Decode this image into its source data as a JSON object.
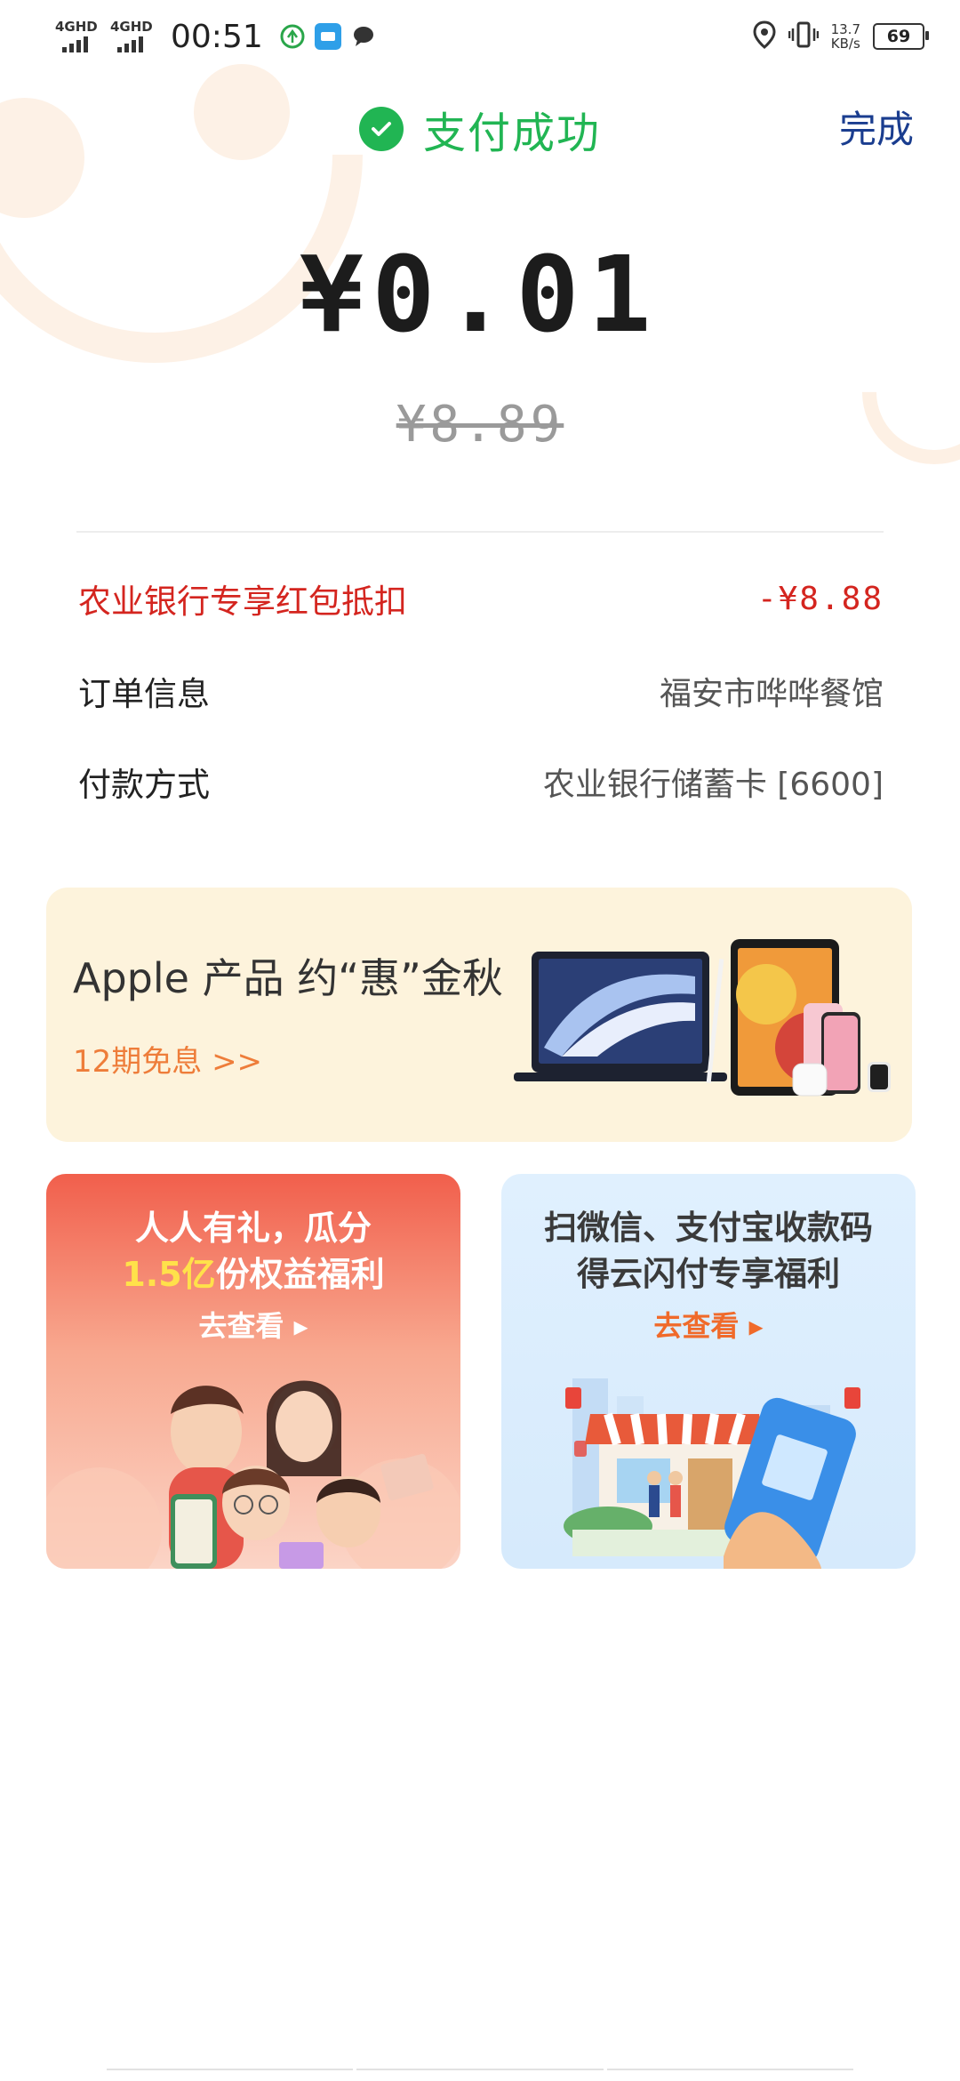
{
  "status_bar": {
    "network1": "4GHD",
    "network2": "4GHD",
    "time": "00:51",
    "speed_value": "13.7",
    "speed_unit": "KB/s",
    "battery": "69"
  },
  "header": {
    "status_text": "支付成功",
    "done_label": "完成"
  },
  "payment": {
    "amount": "¥0.01",
    "original_amount": "¥8.89"
  },
  "details": {
    "discount_label": "农业银行专享红包抵扣",
    "discount_value": "-¥8.88",
    "order_label": "订单信息",
    "order_value": "福安市哗哗餐馆",
    "method_label": "付款方式",
    "method_value": "农业银行储蓄卡 [6600]"
  },
  "apple_banner": {
    "title": "Apple 产品 约“惠”金秋",
    "subtitle": "12期免息 >>"
  },
  "promo_left": {
    "line1": "人人有礼，瓜分",
    "line2_highlight": "1.5亿",
    "line2_rest": "份权益福利",
    "cta": "去查看 ▸"
  },
  "promo_right": {
    "line1": "扫微信、支付宝收款码",
    "line2": "得云闪付专享福利",
    "cta": "去查看 ▸"
  },
  "colors": {
    "success_green": "#21b553",
    "done_blue": "#1a3d8f",
    "discount_red": "#d4251f",
    "accent_orange": "#ee7d3a"
  }
}
